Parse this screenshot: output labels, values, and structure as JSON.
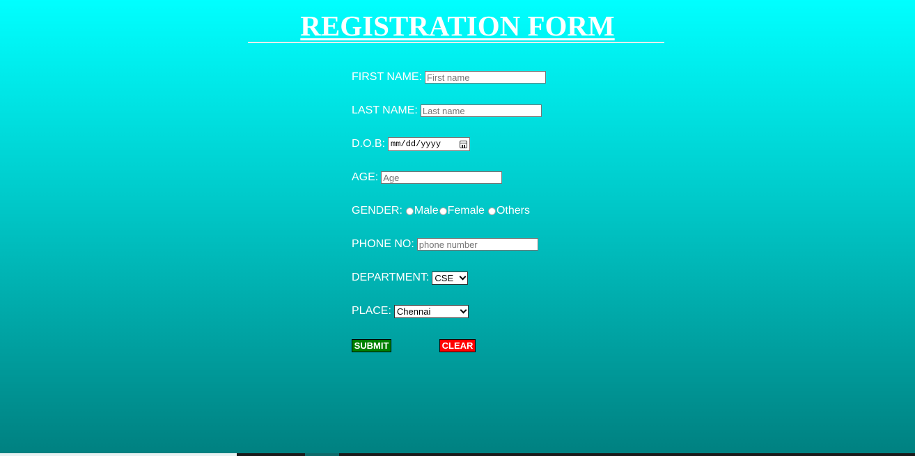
{
  "page": {
    "title": "REGISTRATION FORM"
  },
  "form": {
    "first_name": {
      "label": "FIRST NAME:",
      "placeholder": "First name"
    },
    "last_name": {
      "label": "LAST NAME:",
      "placeholder": "Last name"
    },
    "dob": {
      "label": "D.O.B:",
      "placeholder": "mm/dd/yyyy"
    },
    "age": {
      "label": "AGE:",
      "placeholder": "Age"
    },
    "gender": {
      "label": "GENDER:",
      "options": [
        "Male",
        "Female",
        "Others"
      ]
    },
    "phone": {
      "label": "PHONE NO:",
      "placeholder": "phone number"
    },
    "department": {
      "label": "DEPARTMENT:",
      "selected": "CSE"
    },
    "place": {
      "label": "PLACE:",
      "selected": "Chennai"
    }
  },
  "buttons": {
    "submit": "SUBMIT",
    "clear": "CLEAR"
  },
  "colors": {
    "background_top": "#00ffff",
    "background_bottom": "#008080",
    "submit": "#008000",
    "clear": "#ff0000",
    "text": "#ffffff"
  },
  "icons": {
    "date_picker": "calendar-icon",
    "select_arrow": "chevron-down-icon"
  }
}
